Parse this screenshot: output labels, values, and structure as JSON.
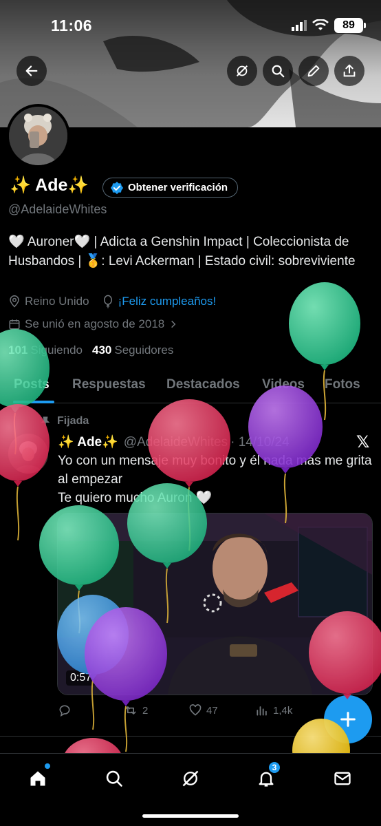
{
  "status_bar": {
    "time": "11:06",
    "battery": "89"
  },
  "profile": {
    "name": "✨ Ade✨",
    "verify_button": "Obtener verificación",
    "handle": "@AdelaideWhites",
    "bio": "🤍 Auroner🤍 | Adicta a Genshin Impact | Coleccionista de Husbandos | 🥇: Levi Ackerman | Estado civil: sobreviviente",
    "location": "Reino Unido",
    "birthday_link": "¡Feliz cumpleaños!",
    "joined": "Se unió en agosto de 2018",
    "following_count": "101",
    "following_label": "Siguiendo",
    "followers_count": "430",
    "followers_label": "Seguidores"
  },
  "tabs": [
    {
      "label": "Posts"
    },
    {
      "label": "Respuestas"
    },
    {
      "label": "Destacados"
    },
    {
      "label": "Videos"
    },
    {
      "label": "Fotos"
    }
  ],
  "post": {
    "pinned_label": "Fijada",
    "author_name": "✨ Ade✨",
    "author_handle": "@AdelaideWhites",
    "date": "· 14/10/24",
    "text_line1": "Yo con un mensaje muy bonito y él nada más me grita al empezar",
    "text_line2": "Te quiero mucho Auron 🤍",
    "video_time": "0:57",
    "replies": "",
    "reposts": "2",
    "likes": "47",
    "views": "1,4k"
  },
  "nav": {
    "notifications_badge": "3"
  },
  "icons": [
    "back-arrow-icon",
    "grok-icon",
    "search-icon",
    "pen-icon",
    "share-icon",
    "verified-badge-icon",
    "location-pin-icon",
    "balloon-icon",
    "calendar-icon",
    "chevron-right-icon",
    "pin-icon",
    "x-logo-icon",
    "reply-icon",
    "repost-icon",
    "heart-icon",
    "views-icon",
    "plus-icon",
    "home-icon",
    "notifications-icon",
    "mail-icon"
  ],
  "colors": {
    "accent": "#1d9bf0",
    "background": "#000000",
    "secondary_text": "#71767b"
  }
}
